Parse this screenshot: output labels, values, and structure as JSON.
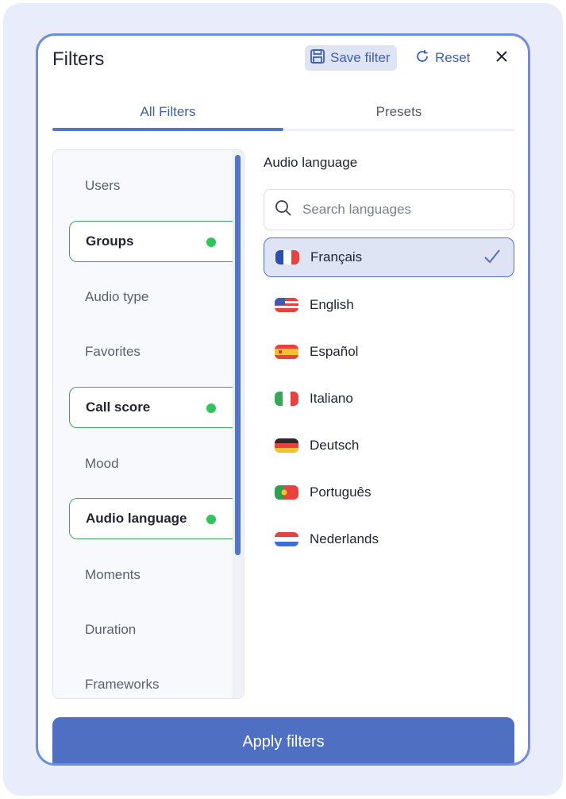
{
  "header": {
    "title": "Filters",
    "save_label": "Save filter",
    "reset_label": "Reset"
  },
  "tabs": [
    {
      "label": "All Filters",
      "active": true
    },
    {
      "label": "Presets",
      "active": false
    }
  ],
  "categories": [
    {
      "label": "Users",
      "active": false
    },
    {
      "label": "Groups",
      "active": true
    },
    {
      "label": "Audio type",
      "active": false
    },
    {
      "label": "Favorites",
      "active": false
    },
    {
      "label": "Call score",
      "active": true
    },
    {
      "label": "Mood",
      "active": false
    },
    {
      "label": "Audio language",
      "active": true
    },
    {
      "label": "Moments",
      "active": false
    },
    {
      "label": "Duration",
      "active": false
    },
    {
      "label": "Frameworks",
      "active": false
    }
  ],
  "audio_language": {
    "title": "Audio language",
    "search_placeholder": "Search languages",
    "languages": [
      {
        "label": "Français",
        "flag": "france-flag-icon",
        "selected": true
      },
      {
        "label": "English",
        "flag": "us-flag-icon",
        "selected": false
      },
      {
        "label": "Español",
        "flag": "spain-flag-icon",
        "selected": false
      },
      {
        "label": "Italiano",
        "flag": "italy-flag-icon",
        "selected": false
      },
      {
        "label": "Deutsch",
        "flag": "germany-flag-icon",
        "selected": false
      },
      {
        "label": "Português",
        "flag": "portugal-flag-icon",
        "selected": false
      },
      {
        "label": "Nederlands",
        "flag": "netherlands-flag-icon",
        "selected": false
      }
    ]
  },
  "footer": {
    "apply_label": "Apply filters"
  },
  "colors": {
    "accent": "#4f6fc3",
    "active_indicator": "#2ec65a",
    "page_background": "#e9edfb"
  }
}
